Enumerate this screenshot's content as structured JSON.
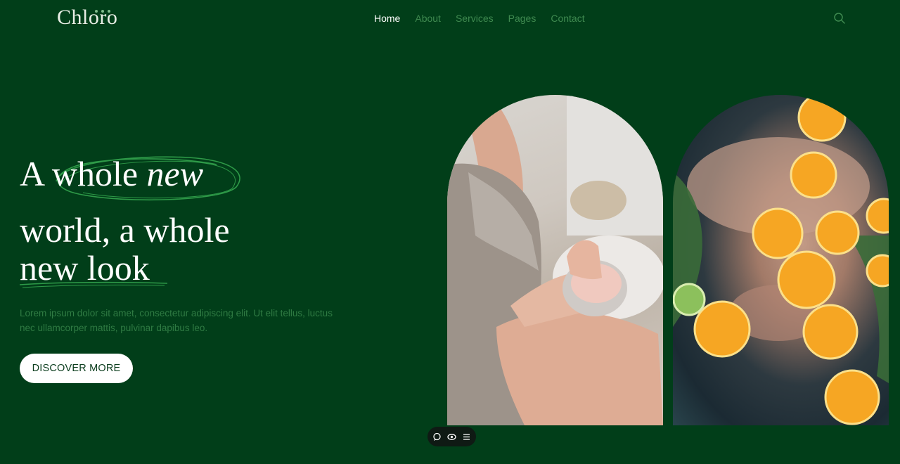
{
  "brand": {
    "name": "Chloro"
  },
  "nav": {
    "items": [
      {
        "label": "Home",
        "active": true
      },
      {
        "label": "About",
        "active": false
      },
      {
        "label": "Services",
        "active": false
      },
      {
        "label": "Pages",
        "active": false
      },
      {
        "label": "Contact",
        "active": false
      }
    ]
  },
  "header": {
    "search_icon": "search-icon"
  },
  "hero": {
    "headline_line1_plain": "A whole ",
    "headline_line1_italic": "new",
    "headline_line2": "world, a whole",
    "headline_line3": "new look",
    "description": "Lorem ipsum dolor sit amet, consectetur adipiscing elit. Ut elit tellus, luctus nec ullamcorper mattis, pulvinar dapibus leo.",
    "cta_label": "DISCOVER MORE"
  },
  "toolbar": {
    "icons": [
      "comment-icon",
      "eye-icon",
      "list-icon"
    ]
  },
  "colors": {
    "background": "#013e19",
    "accent": "#3f8a50",
    "scribble": "#2e9a48",
    "button_bg": "#ffffff"
  }
}
